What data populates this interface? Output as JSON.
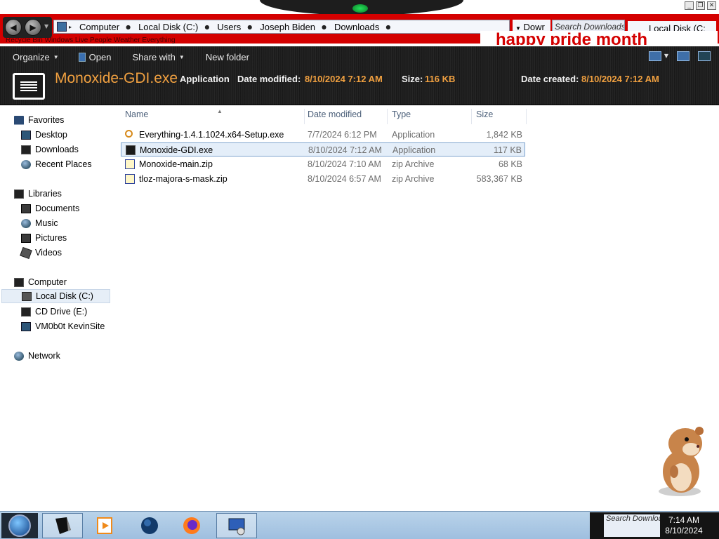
{
  "window": {
    "controls": [
      "_",
      "❐",
      "✕"
    ]
  },
  "address": {
    "crumbs": [
      "Computer",
      "Local Disk (C:)",
      "Users",
      "Joseph Biden",
      "Downloads"
    ],
    "ghost_overlay": "Downloads",
    "tab_partial": "Dowr",
    "search_placeholder": "Search Downloads",
    "local_tab": "Local Disk (C:",
    "banner": "happy pride month",
    "ghost_text": "Recycle Bin   Windows Live   People   Weather   Everything"
  },
  "toolbar": {
    "organize": "Organize",
    "open": "Open",
    "share_with": "Share with",
    "new_folder": "New folder"
  },
  "details": {
    "filename": "Monoxide-GDI.exe",
    "kind": "Application",
    "modified_label": "Date modified:",
    "modified_value": "8/10/2024 7:12 AM",
    "size_label": "Size:",
    "size_value": "116 KB",
    "created_label": "Date created:",
    "created_value": "8/10/2024 7:12 AM"
  },
  "nav": {
    "favorites": "Favorites",
    "desktop": "Desktop",
    "downloads": "Downloads",
    "recent_places": "Recent Places",
    "libraries": "Libraries",
    "documents": "Documents",
    "music": "Music",
    "pictures": "Pictures",
    "videos": "Videos",
    "computer": "Computer",
    "local_disk": "Local Disk (C:)",
    "cd_drive": "CD Drive (E:)",
    "network_drive": "VM0b0t KevinSite",
    "network": "Network"
  },
  "columns": {
    "name": "Name",
    "date_modified": "Date modified",
    "type": "Type",
    "size": "Size"
  },
  "files": [
    {
      "name": "Everything-1.4.1.1024.x64-Setup.exe",
      "date": "7/7/2024 6:12 PM",
      "type": "Application",
      "size": "1,842 KB",
      "icon": "search-icon"
    },
    {
      "name": "Monoxide-GDI.exe",
      "date": "8/10/2024 7:12 AM",
      "type": "Application",
      "size": "117 KB",
      "icon": "app-icon"
    },
    {
      "name": "Monoxide-main.zip",
      "date": "8/10/2024 7:10 AM",
      "type": "zip Archive",
      "size": "68 KB",
      "icon": "zip-icon"
    },
    {
      "name": "tloz-majora-s-mask.zip",
      "date": "8/10/2024 6:57 AM",
      "type": "zip Archive",
      "size": "583,367 KB",
      "icon": "zip-icon"
    }
  ],
  "taskbar": {
    "tray_search": "Search Downloads",
    "time": "7:14 AM",
    "date": "8/10/2024"
  },
  "colors": {
    "accent_orange": "#f0a040",
    "banner_red": "#d40000",
    "taskbar_blue": "#9fbfdf"
  }
}
